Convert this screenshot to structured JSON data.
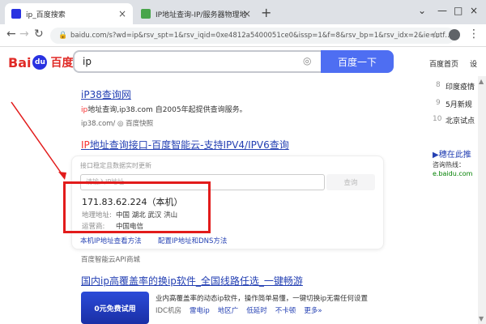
{
  "tabs": [
    {
      "label": "ip_百度搜索",
      "active": true
    },
    {
      "label": "IP地址查询-IP/服务器物理地址",
      "active": false
    }
  ],
  "address": {
    "url": "baidu.com/s?wd=ip&rsv_spt=1&rsv_iqid=0xe4812a5400051ce0&issp=1&f=8&rsv_bp=1&rsv_idx=2&ie=utf…"
  },
  "search": {
    "query": "ip",
    "button_label": "百度一下"
  },
  "header_links": [
    "百度首页",
    "设"
  ],
  "results": [
    {
      "title": "iP38查询网",
      "desc_hl": "ip",
      "desc": "地址查询,ip38.com 自2005年起提供查询服务。",
      "url": "ip38.com/",
      "snapshot": "百度快照"
    },
    {
      "title_hl": "IP",
      "title": "地址查询接口-百度智能云-支持IPV4/IPV6查询"
    }
  ],
  "ip_card": {
    "notice": "接口稳定且数据实时更新",
    "input_placeholder": "请输入IP地址",
    "query_button": "查询",
    "ip": "171.83.62.224（本机）",
    "location_label": "地理地址:",
    "location": "中国 湖北 武汉 洪山",
    "isp_label": "运营商:",
    "isp": "中国电信",
    "link1": "本机IP地址查看方法",
    "link2": "配置IP地址和DNS方法",
    "source": "百度智能云API商城"
  },
  "result3": {
    "title": "国内ip高覆盖率的换ip软件_全国线路任选_一键畅游",
    "desc": "业内高覆盖率的动态ip软件，操作简单易懂，一键切换ip无需任何设置",
    "tags": [
      "IDC机房",
      "雷电ip",
      "地区广",
      "低延时",
      "不卡顿",
      "更多»"
    ],
    "banner": "0元免费试用"
  },
  "sidebar": {
    "numbers": [
      "8",
      "9",
      "10"
    ],
    "items": [
      "印度疫情",
      "5月新规",
      "北京试点"
    ],
    "promo_title": "▶穗在此推",
    "promo_sub": "咨询热线：",
    "promo_url": "e.baidu.com"
  }
}
